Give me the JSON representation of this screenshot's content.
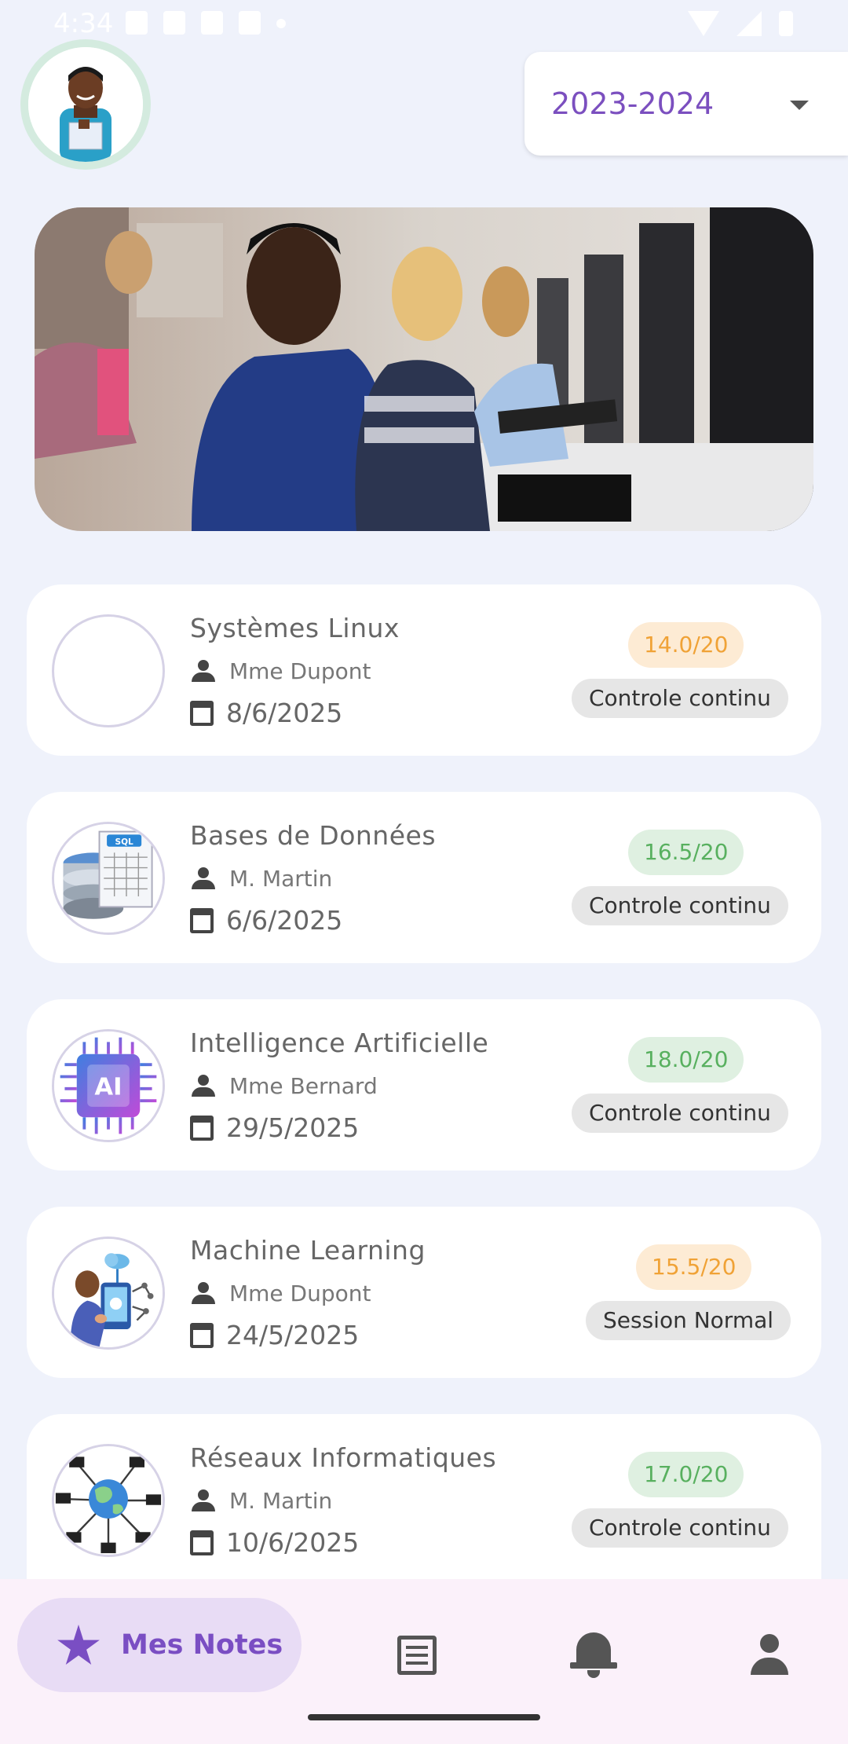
{
  "status_bar": {
    "time": "4:34"
  },
  "header": {
    "year_selector": {
      "value": "2023-2024"
    }
  },
  "grades": [
    {
      "subject": "Systèmes Linux",
      "teacher": "Mme Dupont",
      "date": "8/6/2025",
      "grade": "14.0/20",
      "grade_color": "orange",
      "type": "Controle continu",
      "icon": "empty-logo"
    },
    {
      "subject": "Bases de Données",
      "teacher": "M. Martin",
      "date": "6/6/2025",
      "grade": "16.5/20",
      "grade_color": "green",
      "type": "Controle continu",
      "icon": "database-sql-icon"
    },
    {
      "subject": "Intelligence Artificielle",
      "teacher": "Mme Bernard",
      "date": "29/5/2025",
      "grade": "18.0/20",
      "grade_color": "green",
      "type": "Controle continu",
      "icon": "ai-chip-icon"
    },
    {
      "subject": "Machine Learning",
      "teacher": "Mme Dupont",
      "date": "24/5/2025",
      "grade": "15.5/20",
      "grade_color": "orange",
      "type": "Session Normal",
      "icon": "machine-learning-icon"
    },
    {
      "subject": "Réseaux Informatiques",
      "teacher": "M. Martin",
      "date": "10/6/2025",
      "grade": "17.0/20",
      "grade_color": "green",
      "type": "Controle continu",
      "icon": "network-globe-icon"
    }
  ],
  "bottom_nav": {
    "items": [
      {
        "label": "Mes Notes",
        "icon": "star-icon",
        "active": true
      },
      {
        "label": "",
        "icon": "list-icon",
        "active": false
      },
      {
        "label": "",
        "icon": "bell-icon",
        "active": false
      },
      {
        "label": "",
        "icon": "user-icon",
        "active": false
      }
    ]
  },
  "colors": {
    "accent": "#7a4ec3",
    "background": "#eff2fb",
    "grade_orange": "#f0a236",
    "grade_green": "#58b05f"
  }
}
